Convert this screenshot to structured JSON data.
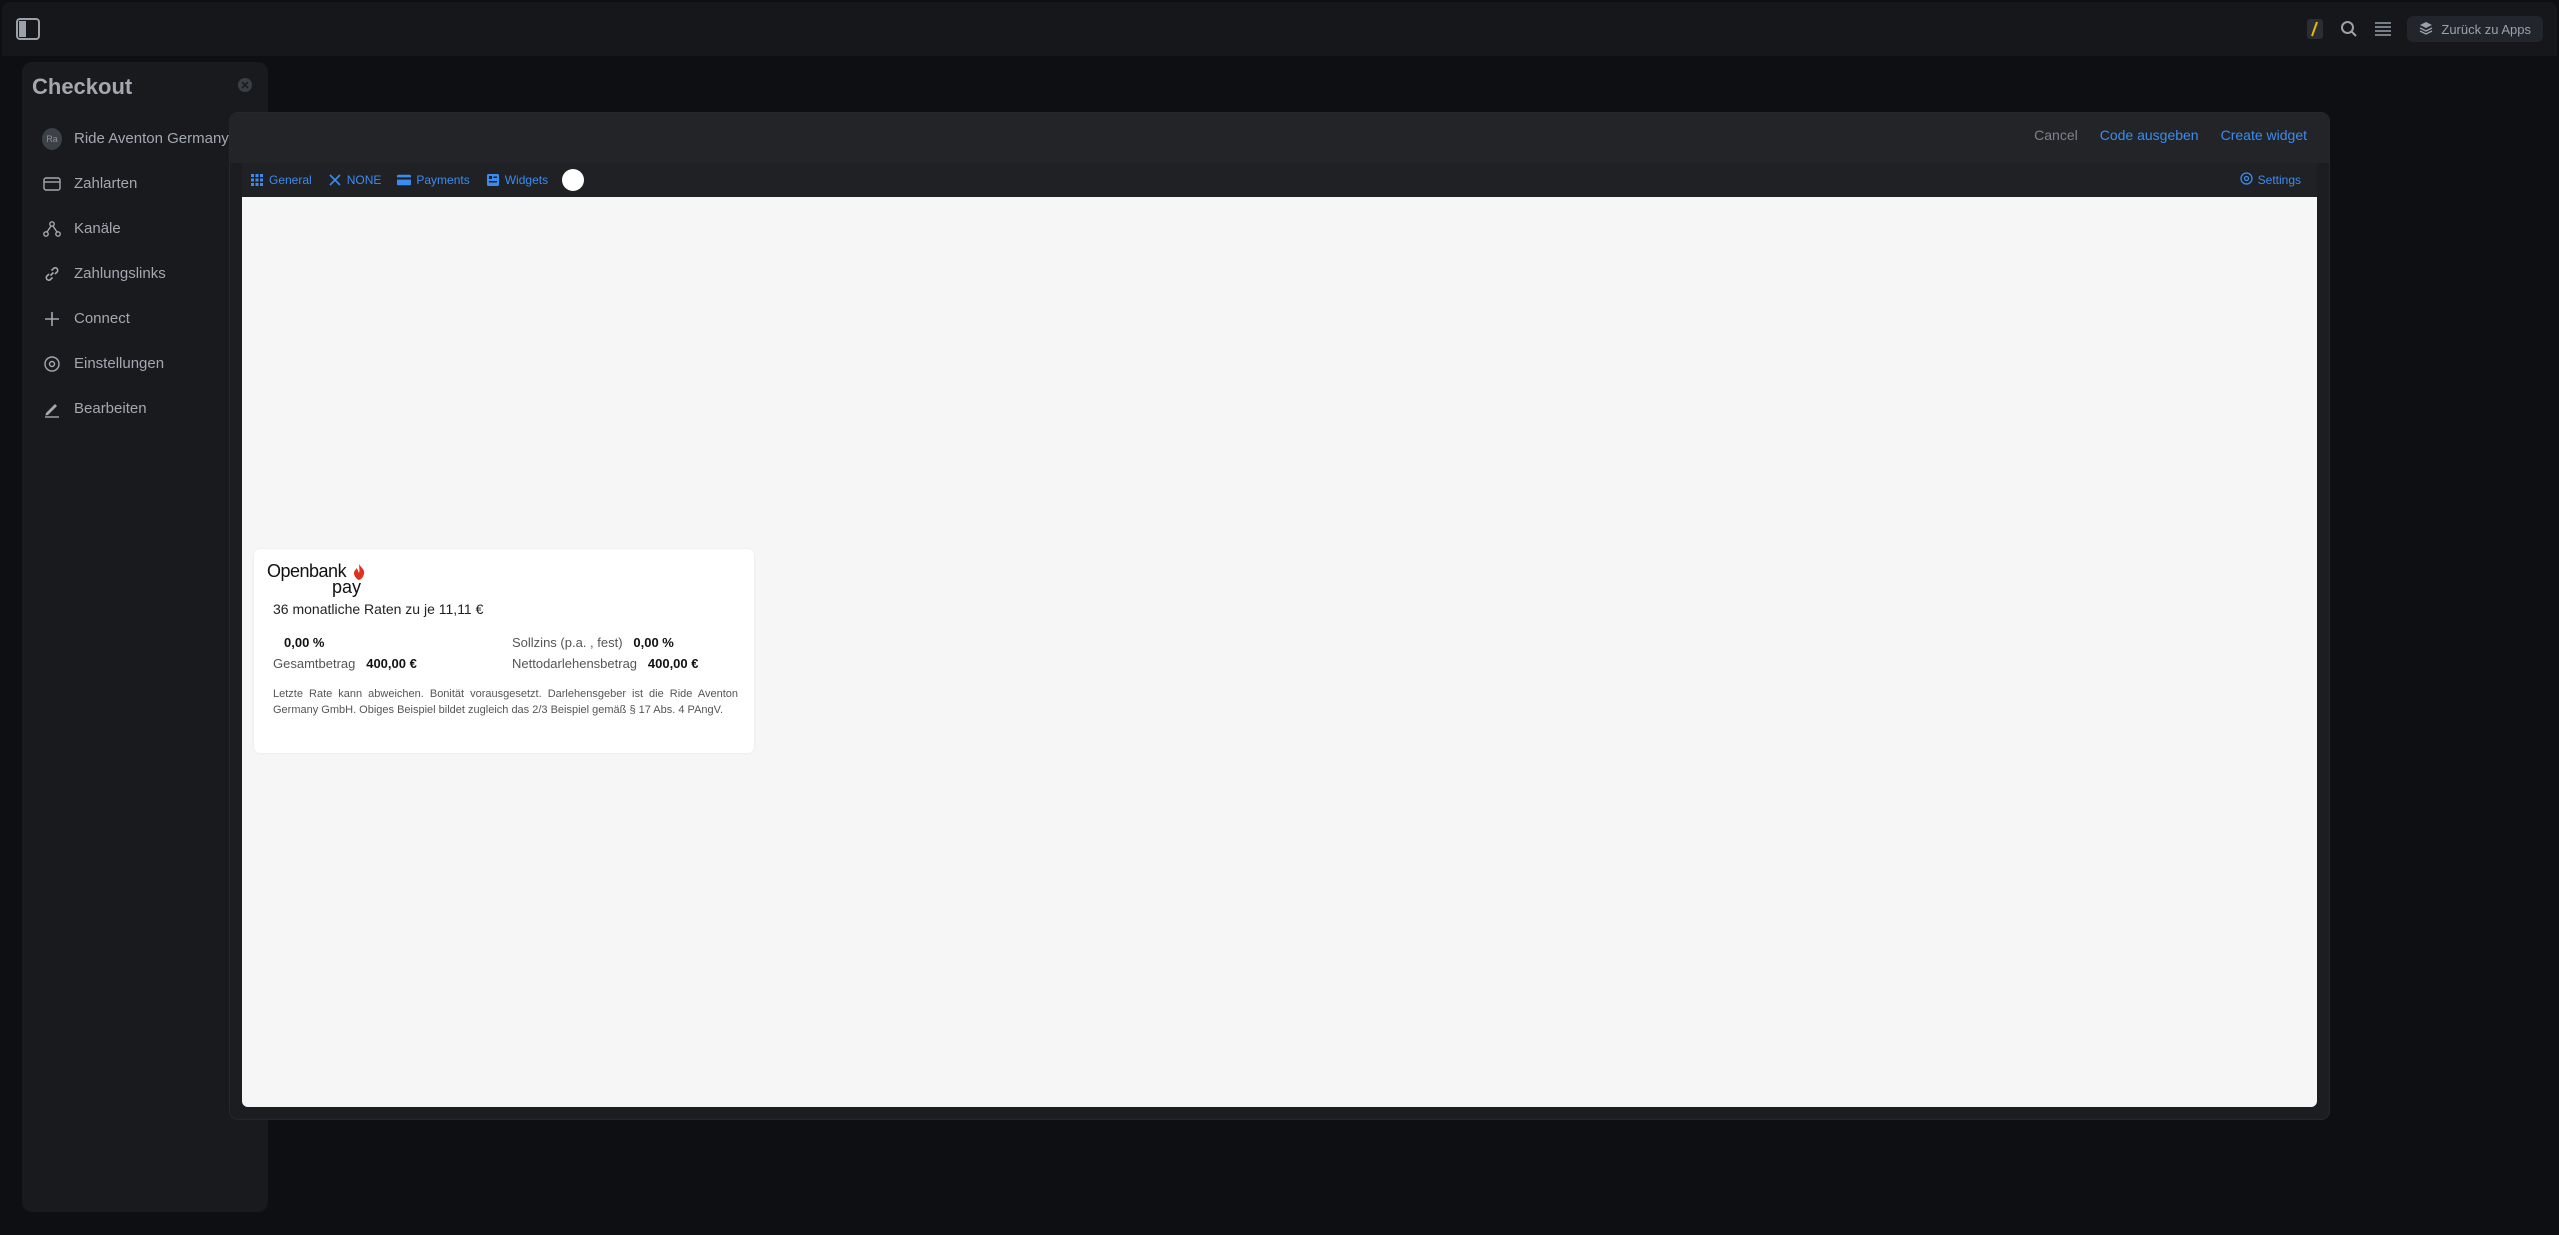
{
  "topbar": {
    "back_label": "Zurück zu Apps"
  },
  "sidebar": {
    "title": "Checkout",
    "items": [
      {
        "label": "Ride Aventon Germany GmbH",
        "avatar": "Ra"
      },
      {
        "label": "Zahlarten",
        "icon": "credit-card-icon"
      },
      {
        "label": "Kanäle",
        "icon": "network-icon"
      },
      {
        "label": "Zahlungslinks",
        "icon": "link-icon"
      },
      {
        "label": "Connect",
        "icon": "plus-icon"
      },
      {
        "label": "Einstellungen",
        "icon": "settings-icon"
      },
      {
        "label": "Bearbeiten",
        "icon": "pen-icon"
      }
    ]
  },
  "modal": {
    "actions": {
      "cancel": "Cancel",
      "code": "Code ausgeben",
      "create": "Create widget"
    },
    "tabs": [
      {
        "label": "General",
        "icon": "grid-icon"
      },
      {
        "label": "NONE",
        "icon": "close-icon"
      },
      {
        "label": "Payments",
        "icon": "card-icon"
      },
      {
        "label": "Widgets",
        "icon": "widget-icon"
      }
    ],
    "settings_label": "Settings"
  },
  "widget": {
    "logo_line1": "Openbank",
    "logo_line2": "pay",
    "rate_line": "36 monatliche Raten zu je 11,11 €",
    "effective_rate": "0,00 %",
    "sollzins_label": "Sollzins (p.a. , fest)",
    "sollzins_value": "0,00 %",
    "gesamt_label": "Gesamtbetrag",
    "gesamt_value": "400,00 €",
    "netto_label": "Nettodarlehensbetrag",
    "netto_value": "400,00 €",
    "disclaimer": "Letzte Rate kann abweichen. Bonität vorausgesetzt. Darlehensgeber ist die Ride Aventon Germany GmbH. Obiges Beispiel bildet zugleich das 2/3 Beispiel gemäß § 17 Abs. 4 PAngV."
  },
  "colors": {
    "accent": "#3b8cf0",
    "logo_flame": "#e0301e"
  }
}
